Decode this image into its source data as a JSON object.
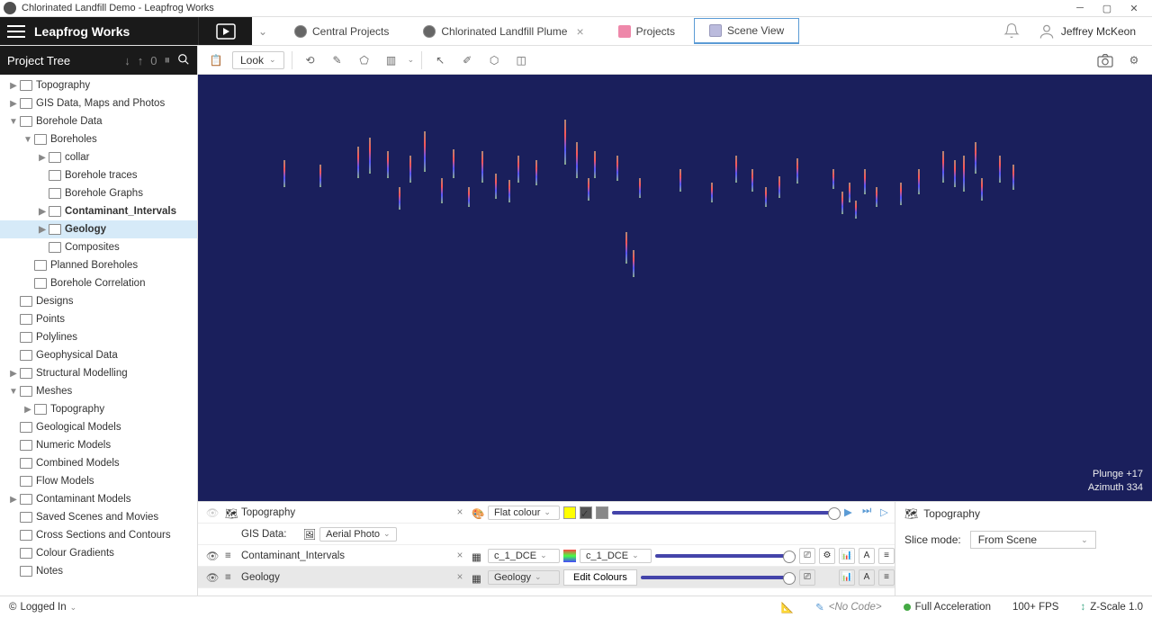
{
  "title": "Chlorinated Landfill Demo - Leapfrog Works",
  "app_name": "Leapfrog Works",
  "nav_tabs": [
    {
      "label": "Central Projects",
      "closable": false
    },
    {
      "label": "Chlorinated Landfill Plume",
      "closable": true
    },
    {
      "label": "Projects",
      "closable": false
    },
    {
      "label": "Scene View",
      "closable": false,
      "active": true
    }
  ],
  "user": {
    "name": "Jeffrey McKeon"
  },
  "sidebar": {
    "title": "Project Tree"
  },
  "tree": [
    {
      "l": 0,
      "exp": "▶",
      "label": "Topography"
    },
    {
      "l": 0,
      "exp": "▶",
      "label": "GIS Data, Maps and Photos"
    },
    {
      "l": 0,
      "exp": "▼",
      "label": "Borehole Data"
    },
    {
      "l": 1,
      "exp": "▼",
      "label": "Boreholes"
    },
    {
      "l": 2,
      "exp": "▶",
      "label": "collar"
    },
    {
      "l": 2,
      "exp": "",
      "label": "Borehole traces"
    },
    {
      "l": 2,
      "exp": "",
      "label": "Borehole Graphs"
    },
    {
      "l": 2,
      "exp": "▶",
      "label": "Contaminant_Intervals",
      "bold": true
    },
    {
      "l": 2,
      "exp": "▶",
      "label": "Geology",
      "bold": true,
      "selected": true
    },
    {
      "l": 2,
      "exp": "",
      "label": "Composites"
    },
    {
      "l": 1,
      "exp": "",
      "label": "Planned Boreholes"
    },
    {
      "l": 1,
      "exp": "",
      "label": "Borehole Correlation"
    },
    {
      "l": 0,
      "exp": "",
      "label": "Designs"
    },
    {
      "l": 0,
      "exp": "",
      "label": "Points"
    },
    {
      "l": 0,
      "exp": "",
      "label": "Polylines"
    },
    {
      "l": 0,
      "exp": "",
      "label": "Geophysical Data"
    },
    {
      "l": 0,
      "exp": "▶",
      "label": "Structural Modelling"
    },
    {
      "l": 0,
      "exp": "▼",
      "label": "Meshes"
    },
    {
      "l": 1,
      "exp": "▶",
      "label": "Topography"
    },
    {
      "l": 0,
      "exp": "",
      "label": "Geological Models"
    },
    {
      "l": 0,
      "exp": "",
      "label": "Numeric Models"
    },
    {
      "l": 0,
      "exp": "",
      "label": "Combined Models"
    },
    {
      "l": 0,
      "exp": "",
      "label": "Flow Models"
    },
    {
      "l": 0,
      "exp": "▶",
      "label": "Contaminant Models"
    },
    {
      "l": 0,
      "exp": "",
      "label": "Saved Scenes and Movies"
    },
    {
      "l": 0,
      "exp": "",
      "label": "Cross Sections and Contours"
    },
    {
      "l": 0,
      "exp": "",
      "label": "Colour Gradients"
    },
    {
      "l": 0,
      "exp": "",
      "label": "Notes"
    }
  ],
  "toolbar": {
    "look": "Look"
  },
  "viewport": {
    "plunge": "Plunge  +17",
    "azimuth": "Azimuth  334"
  },
  "shape_list": {
    "rows": [
      {
        "visible": false,
        "name": "Topography",
        "style": "Flat colour"
      },
      {
        "sub": true,
        "label": "GIS Data:",
        "value": "Aerial Photo"
      },
      {
        "visible": true,
        "name": "Contaminant_Intervals",
        "style": "c_1_DCE",
        "colour": "c_1_DCE"
      },
      {
        "visible": true,
        "name": "Geology",
        "style": "Geology",
        "colour_btn": "Edit Colours",
        "selected": true
      }
    ]
  },
  "properties": {
    "title": "Topography",
    "slice_label": "Slice mode:",
    "slice_value": "From Scene"
  },
  "status": {
    "login": "Logged In",
    "code": "<No Code>",
    "accel": "Full Acceleration",
    "fps": "100+ FPS",
    "zscale": "Z-Scale 1.0"
  }
}
